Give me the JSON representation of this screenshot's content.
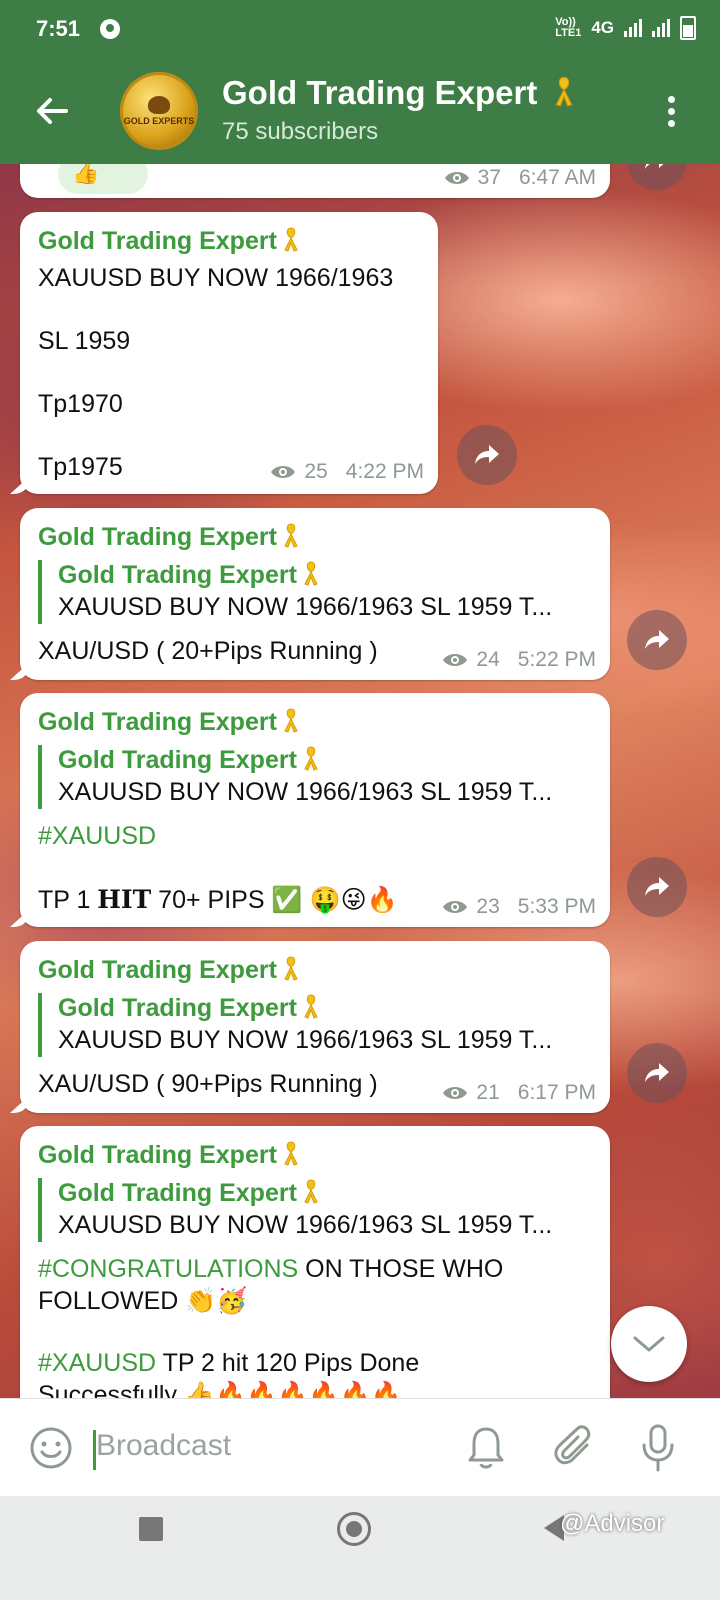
{
  "status": {
    "time": "7:51",
    "network": "4G",
    "volte": "VoLTE1"
  },
  "header": {
    "title": "Gold Trading Expert",
    "subtitle": "75 subscribers",
    "avatar_text": "GOLD EXPERTS"
  },
  "messages": [
    {
      "views": "37",
      "time": "6:47 AM"
    },
    {
      "sender": "Gold Trading Expert",
      "lines": [
        "XAUUSD  BUY  NOW 1966/1963",
        "SL 1959",
        "Tp1970",
        "Tp1975"
      ],
      "views": "25",
      "time": "4:22 PM"
    },
    {
      "sender": "Gold Trading Expert",
      "reply_name": "Gold Trading Expert",
      "reply_text": "XAUUSD  BUY  NOW 1966/1963  SL 1959  T...",
      "text": "XAU/USD ( 20+Pips  Running )",
      "views": "24",
      "time": "5:22 PM"
    },
    {
      "sender": "Gold Trading Expert",
      "reply_name": "Gold Trading Expert",
      "reply_text": "XAUUSD  BUY  NOW 1966/1963  SL 1959  T...",
      "hashtag": "#XAUUSD",
      "text_a": "TP 1 ",
      "text_b": "HIT",
      "text_c": " 70+ PIPS ✅ 🤑😜🔥",
      "views": "23",
      "time": "5:33 PM"
    },
    {
      "sender": "Gold Trading Expert",
      "reply_name": "Gold Trading Expert",
      "reply_text": "XAUUSD  BUY  NOW 1966/1963  SL 1959  T...",
      "text": "XAU/USD ( 90+Pips  Running )",
      "views": "21",
      "time": "6:17 PM"
    },
    {
      "sender": "Gold Trading Expert",
      "reply_name": "Gold Trading Expert",
      "reply_text": "XAUUSD  BUY  NOW 1966/1963  SL 1959  T...",
      "hashtag1": "#CONGRATULATIONS",
      "text1": " ON THOSE WHO",
      "text2": "FOLLOWED  👏🥳",
      "hashtag2": "#XAUUSD",
      "text3": "  TP 2  hit  120 Pips Done",
      "text4": "Successfully 👍🔥🔥🔥🔥🔥🔥"
    }
  ],
  "input": {
    "placeholder": "Broadcast"
  },
  "watermark": "@Advisor",
  "colors": {
    "header": "#3f7d47",
    "accent": "#3d9a3d",
    "ribbon": "#f2c01a"
  }
}
